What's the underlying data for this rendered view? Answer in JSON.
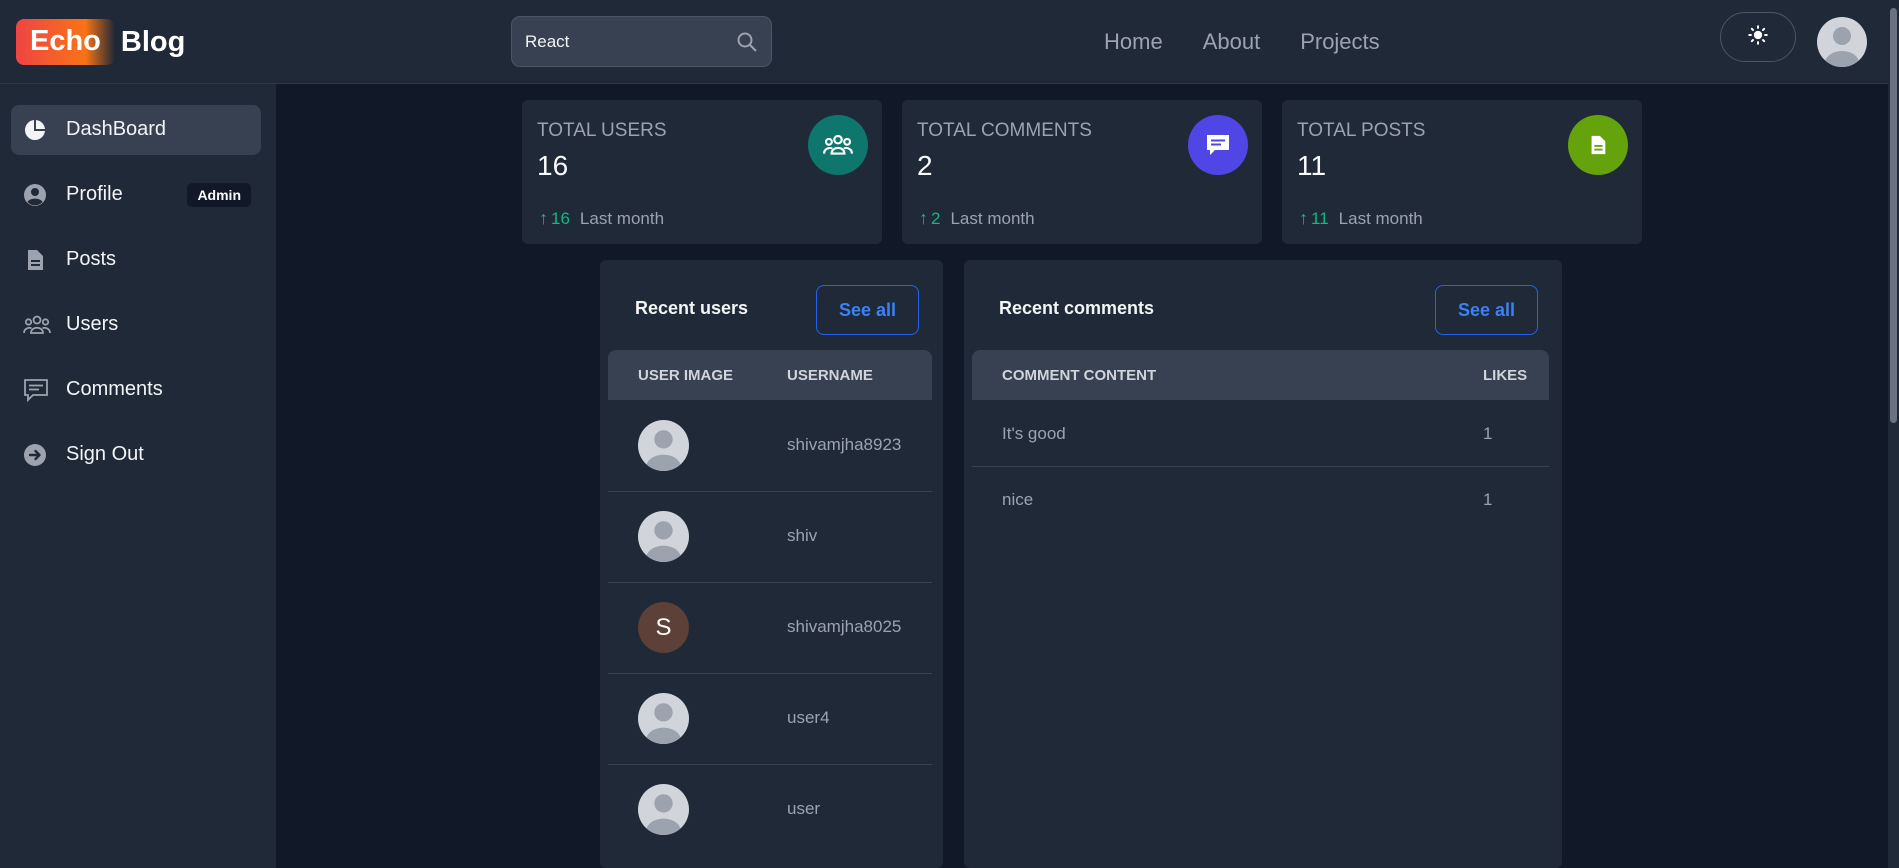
{
  "header": {
    "logo_part1": "Echo",
    "logo_part2": "Blog",
    "search_value": "React",
    "nav": [
      "Home",
      "About",
      "Projects"
    ]
  },
  "sidebar": {
    "items": [
      {
        "label": "DashBoard",
        "icon": "pie-chart-icon"
      },
      {
        "label": "Profile",
        "icon": "user-circle-icon",
        "badge": "Admin"
      },
      {
        "label": "Posts",
        "icon": "document-icon"
      },
      {
        "label": "Users",
        "icon": "users-group-icon"
      },
      {
        "label": "Comments",
        "icon": "comment-icon"
      },
      {
        "label": "Sign Out",
        "icon": "arrow-right-circle-icon"
      }
    ]
  },
  "stats": [
    {
      "title": "Total Users",
      "value": "16",
      "change": "16",
      "period": "Last month",
      "icon": "users-group-icon",
      "color": "#0f766e"
    },
    {
      "title": "Total Comments",
      "value": "2",
      "change": "2",
      "period": "Last month",
      "icon": "comment-icon",
      "color": "#4f46e5"
    },
    {
      "title": "Total Posts",
      "value": "11",
      "change": "11",
      "period": "Last month",
      "icon": "document-icon",
      "color": "#65a30d"
    }
  ],
  "recent_users": {
    "title": "Recent users",
    "see_all": "See all",
    "columns": [
      "User image",
      "Username"
    ],
    "rows": [
      {
        "username": "shivamjha8923",
        "avatar": "default"
      },
      {
        "username": "shiv",
        "avatar": "default"
      },
      {
        "username": "shivamjha8025",
        "avatar": "letter",
        "letter": "S"
      },
      {
        "username": "user4",
        "avatar": "default"
      },
      {
        "username": "user",
        "avatar": "default"
      }
    ]
  },
  "recent_comments": {
    "title": "Recent comments",
    "see_all": "See all",
    "columns": [
      "Comment content",
      "Likes"
    ],
    "rows": [
      {
        "content": "It's good",
        "likes": "1"
      },
      {
        "content": "nice",
        "likes": "1"
      }
    ]
  },
  "colors": {
    "background": "#111827",
    "panel": "#1f2937",
    "accent_blue": "#3b82f6",
    "positive_green": "#10b981"
  }
}
